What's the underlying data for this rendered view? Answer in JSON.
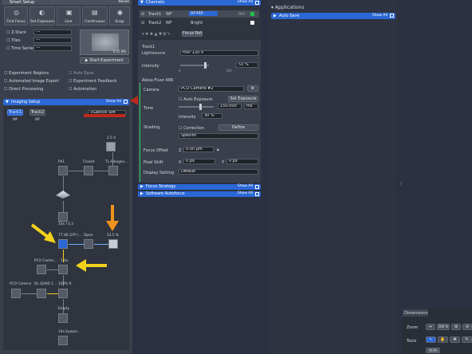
{
  "top_bar": {
    "title": "Smart Setup",
    "right": "Reuse"
  },
  "toolbar": [
    {
      "label": "Find Focus",
      "icon": "focus-icon"
    },
    {
      "label": "Set Exposure",
      "icon": "exposure-icon"
    },
    {
      "label": "Live",
      "icon": "live-icon"
    },
    {
      "label": "Continuous",
      "icon": "continuous-icon"
    },
    {
      "label": "Snap",
      "icon": "snap-icon"
    }
  ],
  "experiment_options": [
    {
      "label": "Z-Stack",
      "value": "---"
    },
    {
      "label": "Tiles",
      "value": "---"
    },
    {
      "label": "Time Series",
      "value": "---"
    }
  ],
  "start_experiment": "Start Experiment",
  "preview_size": "0.25 MB",
  "checkboxes": [
    "Experiment Regions",
    "Auto Save",
    "Automated Image Export",
    "Experiment Feedback",
    "Direct Processing",
    "Automation"
  ],
  "imaging_setup": {
    "title": "Imaging Setup",
    "show_all": "Show All"
  },
  "tracks": [
    "Track1",
    "Track2"
  ],
  "track_mode": [
    "WF",
    "WF"
  ],
  "lattice_mode": "+Lattice SIM",
  "light_path": {
    "lamp_value": "2.5 V",
    "ph1": "Ph1",
    "closed": "Closed",
    "halogen": "TL Halogen...",
    "objective": "10x / 0.3",
    "filter": "77 HE GFP /...",
    "open": "Open",
    "led_level": "53.5 %",
    "pco_camera_top": "PCO Camer...",
    "magnification": "1.6x",
    "pco_camera": "PCO Camera",
    "dl_quad": "DL QUAD 1...",
    "r_100": "100% R",
    "empty": "Empty",
    "eyepiece": "10x Eyepie..."
  },
  "channels": {
    "title": "Channels",
    "show_all": "Show All",
    "rows": [
      {
        "track": "Track1",
        "mode": "WF",
        "name": "AF488",
        "ref": "Ref"
      },
      {
        "track": "Track2",
        "mode": "WF",
        "name": "Bright",
        "ref": ""
      }
    ],
    "focus_ref": "Focus Ref."
  },
  "track1": {
    "title": "Track1",
    "lightsource_label": "Lightsource",
    "lightsource": "HXP 120 V",
    "intensity_label": "Intensity",
    "intensity": "53 %",
    "slider_min": "0",
    "slider_max": "100"
  },
  "alexa": {
    "title": "Alexa Fluor 488",
    "camera_label": "Camera",
    "camera": "PCO Camera #2",
    "auto_exposure": "Auto Exposure",
    "set_exposure": "Set Exposure",
    "time_label": "Time",
    "time_value": "150.000",
    "time_unit": "ms",
    "intensity_label": "Intensity",
    "intensity_value": "30 %",
    "shading_label": "Shading",
    "correction": "Correction",
    "define": "Define",
    "specific": "Specific",
    "focus_offset_label": "Focus Offset",
    "z_label": "Z",
    "z_value": "0.00 µm",
    "pixel_shift_label": "Pixel Shift",
    "x_label": "X",
    "x_value": "0 px",
    "y_label": "Y",
    "y_value": "0 px",
    "display_label": "Display Setting",
    "display_value": "Default"
  },
  "focus_strategy": {
    "title": "Focus Strategy",
    "show_all": "Show All"
  },
  "software_autofocus": {
    "title": "Software Autofocus",
    "show_all": "Show All"
  },
  "applications": {
    "title": "Applications"
  },
  "auto_save": {
    "title": "Auto Save",
    "show_all": "Show All"
  },
  "dimensions": {
    "tab": "Dimensions",
    "zoom_label": "Zoom",
    "zoom_value": "100 %",
    "tools_label": "Tools",
    "all_label": "All/All"
  },
  "colors": {
    "accent": "#2b68d6",
    "annotation_red": "#c0281c",
    "annotation_yellow": "#f2d21a",
    "annotation_orange": "#f0921e"
  }
}
